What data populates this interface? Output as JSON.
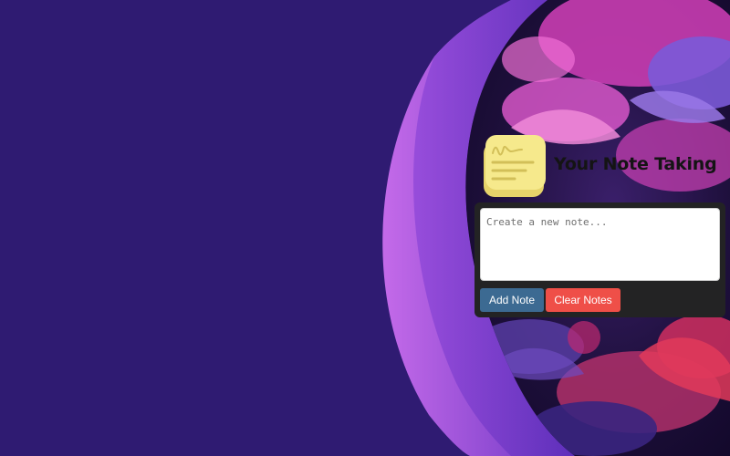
{
  "app": {
    "title": "Your Note Taking",
    "logo_icon": "sticky-note-icon"
  },
  "note_form": {
    "placeholder": "Create a new note...",
    "value": "",
    "add_label": "Add Note",
    "clear_label": "Clear Notes"
  },
  "colors": {
    "background": "#2f1b72",
    "panel": "#232324",
    "add_button": "#3c6a92",
    "clear_button": "#ef4f48",
    "accent_arc": "#b363e8"
  }
}
